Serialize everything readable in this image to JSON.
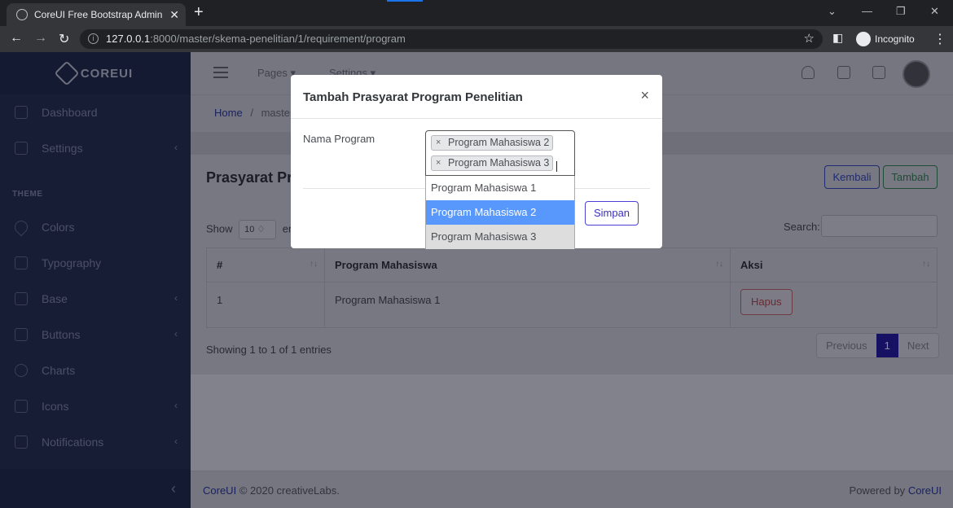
{
  "browser": {
    "tab_title": "CoreUI Free Bootstrap Admin Ten",
    "url_host": "127.0.0.1",
    "url_path": ":8000/master/skema-penelitian/1/requirement/program",
    "incognito_label": "Incognito"
  },
  "sidebar": {
    "brand": "COREUI",
    "items": [
      {
        "label": "Dashboard",
        "icon": "speedometer-icon"
      },
      {
        "label": "Settings",
        "icon": "calculator-icon"
      },
      {
        "label": "Colors",
        "icon": "drop-icon"
      },
      {
        "label": "Typography",
        "icon": "pencil-icon"
      },
      {
        "label": "Base",
        "icon": "puzzle-icon"
      },
      {
        "label": "Buttons",
        "icon": "cursor-icon"
      },
      {
        "label": "Charts",
        "icon": "chart-pie-icon"
      },
      {
        "label": "Icons",
        "icon": "star-icon"
      },
      {
        "label": "Notifications",
        "icon": "bell-icon"
      }
    ],
    "section_theme": "THEME"
  },
  "header": {
    "nav_pages": "Pages ▾",
    "nav_settings": "Settings ▾"
  },
  "breadcrumb": {
    "home": "Home",
    "sep": "/",
    "current": "master"
  },
  "page": {
    "title": "Prasyarat Pr",
    "kembali": "Kembali",
    "tambah": "Tambah",
    "show_label": "Show",
    "entries_label": "entr",
    "show_value": "10 ♢",
    "search_label": "Search:",
    "columns": [
      "#",
      "Program Mahasiswa",
      "Aksi"
    ],
    "rows": [
      {
        "no": "1",
        "program": "Program Mahasiswa 1",
        "action": "Hapus"
      }
    ],
    "info": "Showing 1 to 1 of 1 entries",
    "pager": {
      "prev": "Previous",
      "current": "1",
      "next": "Next"
    }
  },
  "footer": {
    "brand": "CoreUI",
    "copyright": "© 2020 creativeLabs.",
    "powered": "Powered by",
    "powered_brand": "CoreUI"
  },
  "modal": {
    "title": "Tambah Prasyarat Program Penelitian",
    "close": "×",
    "field_label": "Nama Program",
    "selected": [
      "Program Mahasiswa 2",
      "Program Mahasiswa 3"
    ],
    "options": [
      "Program Mahasiswa 1",
      "Program Mahasiswa 2",
      "Program Mahasiswa 3"
    ],
    "save": "Simpan"
  },
  "colors": {
    "accent": "#2a1fa6",
    "highlight": "#5897fb",
    "sidebar": "#2a3650"
  }
}
